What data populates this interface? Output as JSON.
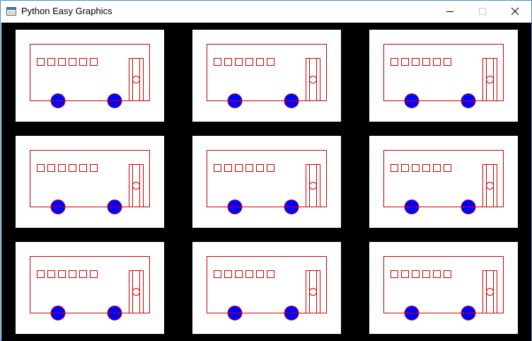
{
  "window": {
    "title": "Python Easy Graphics",
    "icon": "python-window-icon",
    "controls": [
      "minimize-icon",
      "maximize-icon",
      "close-icon"
    ]
  },
  "canvas": {
    "background": "#000000",
    "grid": {
      "rows": 3,
      "columns": 3
    },
    "panel_background": "#ffffff",
    "bus": {
      "outline_color": "#cc0000",
      "wheel_fill": "#0000ff",
      "wheel_outline": "#cc0000",
      "window_count": 6,
      "door_knob": "circle"
    }
  }
}
